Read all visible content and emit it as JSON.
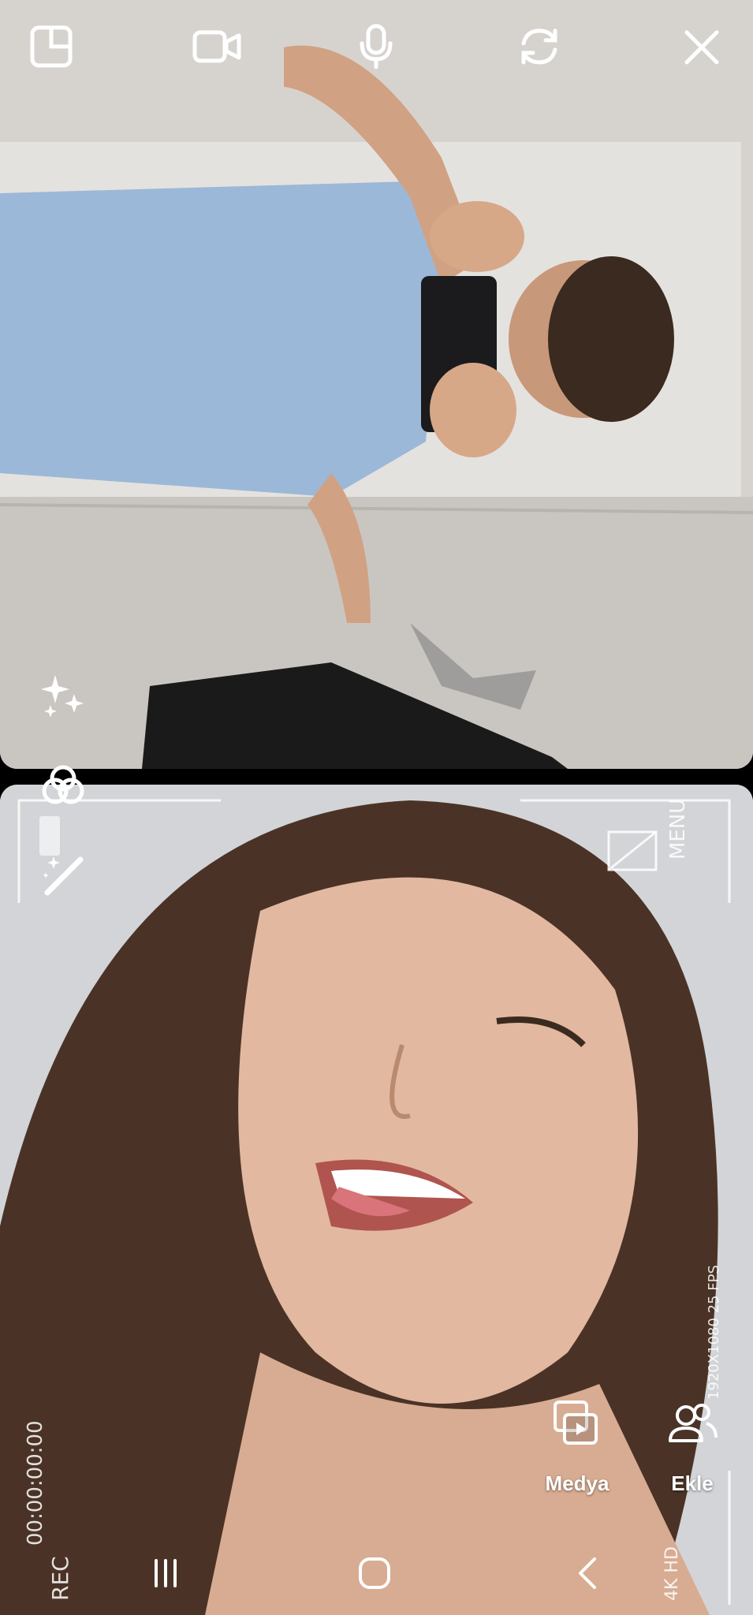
{
  "top_toolbar": {
    "icons": [
      "layout-icon",
      "video-icon",
      "microphone-icon",
      "switch-camera-icon",
      "close-icon"
    ]
  },
  "side_tools": {
    "icons": [
      "sparkles-icon",
      "filters-icon",
      "magic-wand-icon"
    ]
  },
  "camera_overlay": {
    "menu_label": "MENU",
    "resolution_label": "1920X1080 25 FPS",
    "timecode": "00:00:00:00",
    "rec_label": "REC",
    "quality_label": "4K HD"
  },
  "actions": {
    "media_label": "Medya",
    "add_label": "Ekle"
  },
  "nav_bar": {
    "icons": [
      "recent-apps-icon",
      "home-icon",
      "back-icon"
    ]
  }
}
